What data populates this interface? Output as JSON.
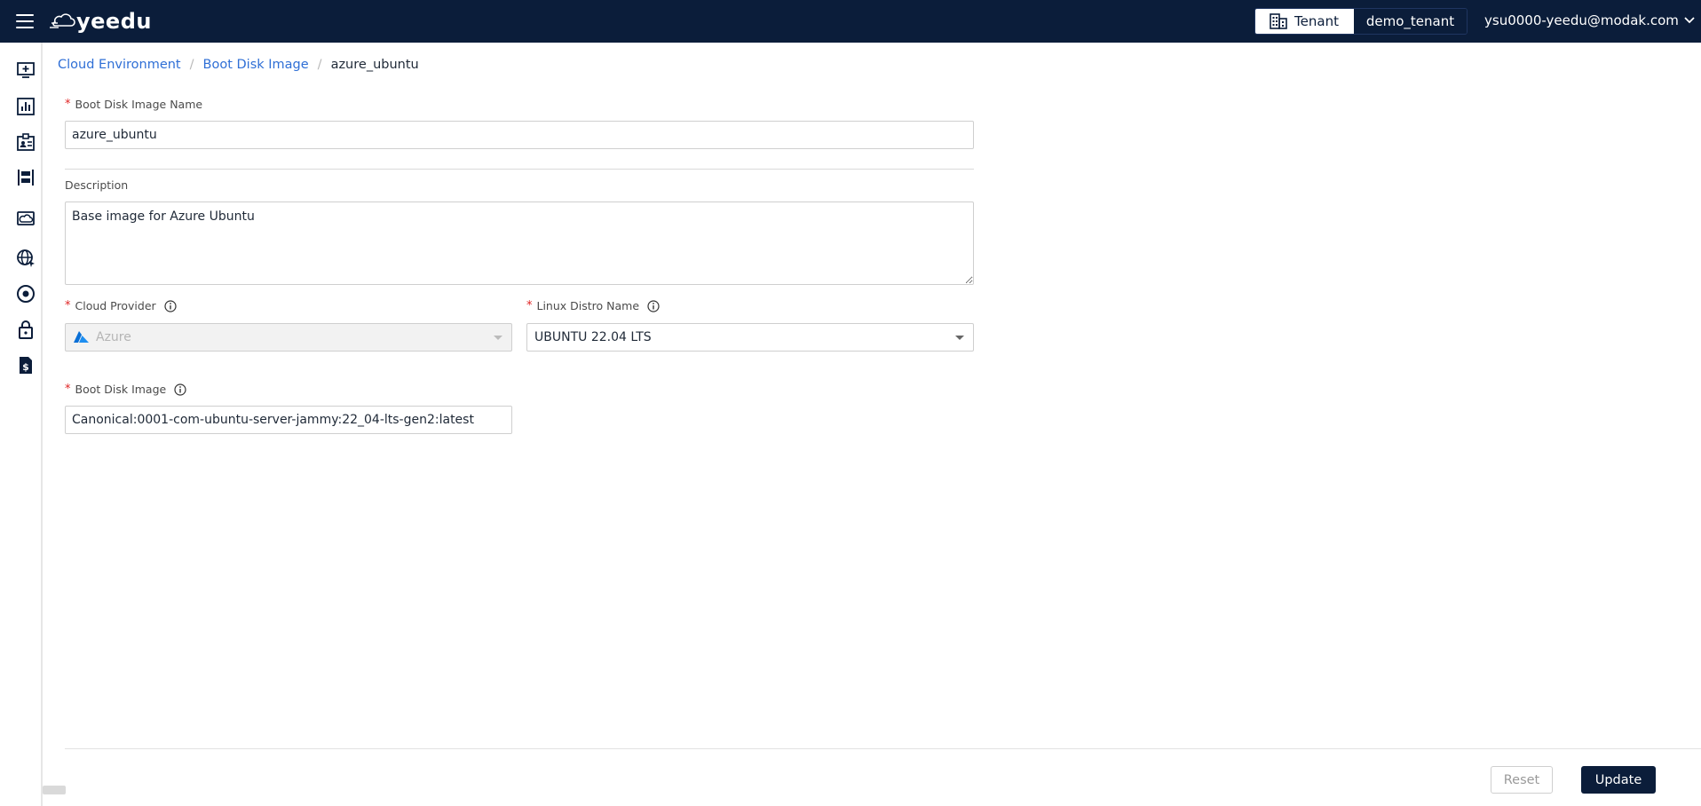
{
  "app": {
    "logo_text": "yeedu"
  },
  "header": {
    "tenant_label": "Tenant",
    "tenant_value": "demo_tenant",
    "user_email": "ysu0000-yeedu@modak.com"
  },
  "sidebar": {
    "items": [
      {
        "icon": "add-screen-icon"
      },
      {
        "icon": "bar-chart-icon"
      },
      {
        "icon": "id-card-icon"
      },
      {
        "icon": "workspace-icon"
      },
      {
        "icon": "cloud-drive-icon"
      },
      {
        "icon": "globe-icon"
      },
      {
        "icon": "disc-icon"
      },
      {
        "icon": "lock-icon"
      },
      {
        "icon": "billing-icon"
      }
    ]
  },
  "breadcrumb": {
    "items": [
      "Cloud Environment",
      "Boot Disk Image"
    ],
    "current": "azure_ubuntu"
  },
  "form": {
    "name_label": "Boot Disk Image Name",
    "name_value": "azure_ubuntu",
    "description_label": "Description",
    "description_value": "Base image for Azure Ubuntu",
    "cloud_provider_label": "Cloud Provider",
    "cloud_provider_value": "Azure",
    "linux_distro_label": "Linux Distro Name",
    "linux_distro_value": "UBUNTU 22.04 LTS",
    "boot_disk_image_label": "Boot Disk Image",
    "boot_disk_image_value": "Canonical:0001-com-ubuntu-server-jammy:22_04-lts-gen2:latest"
  },
  "actions": {
    "reset_label": "Reset",
    "update_label": "Update"
  },
  "colors": {
    "brand_navy": "#0b1d3a",
    "link_blue": "#2f6fd6",
    "required_red": "#e02424"
  }
}
